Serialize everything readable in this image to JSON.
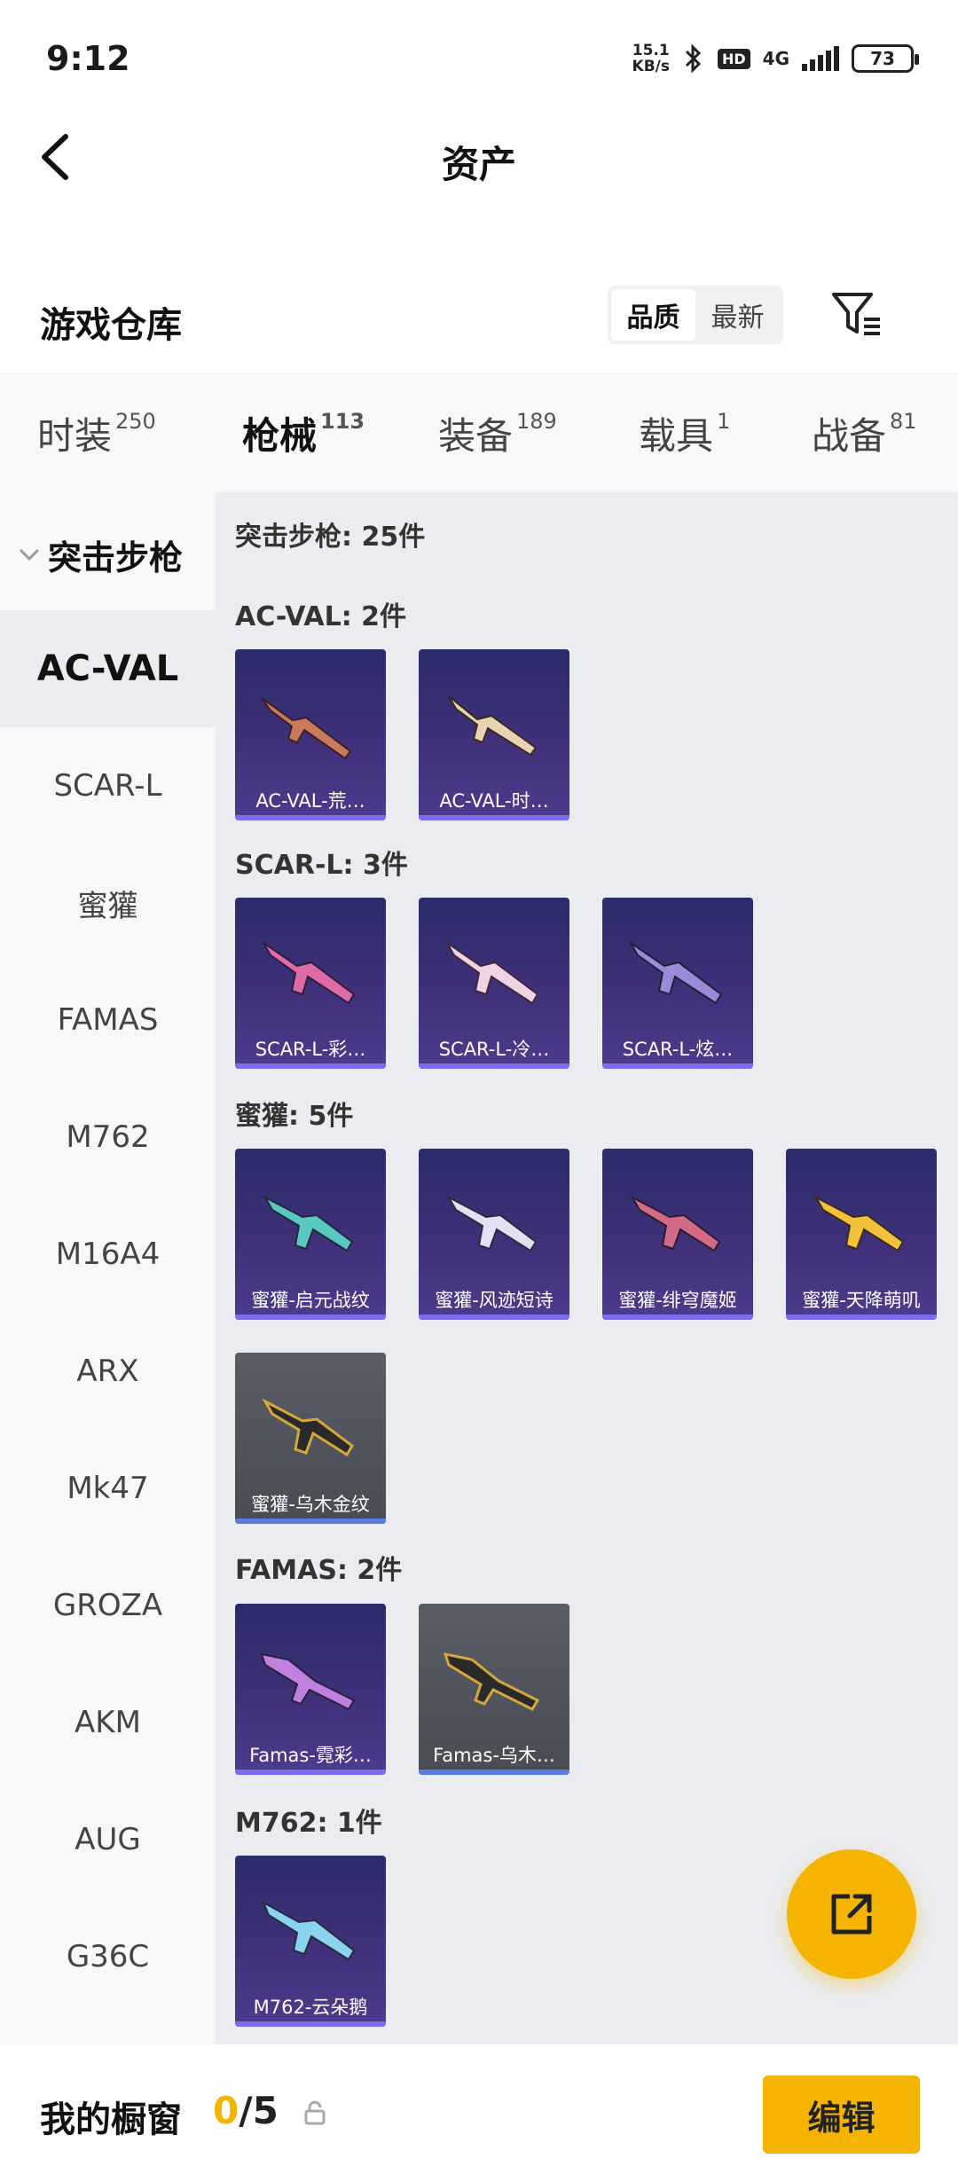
{
  "status_bar": {
    "time": "9:12",
    "speed_value": "15.1",
    "speed_unit": "KB/s",
    "hd_label": "HD",
    "network_label": "4G",
    "battery": "73"
  },
  "nav": {
    "title": "资产"
  },
  "section": {
    "title": "游戏仓库",
    "sort_options": [
      "品质",
      "最新"
    ],
    "active_sort": "品质"
  },
  "tabs": [
    {
      "label": "时装",
      "count": "250"
    },
    {
      "label": "枪械",
      "count": "113"
    },
    {
      "label": "装备",
      "count": "189"
    },
    {
      "label": "载具",
      "count": "1"
    },
    {
      "label": "战备",
      "count": "81"
    }
  ],
  "sidebar": {
    "group": "突击步枪",
    "items": [
      "AC-VAL",
      "SCAR-L",
      "蜜獾",
      "FAMAS",
      "M762",
      "M16A4",
      "ARX",
      "Mk47",
      "GROZA",
      "AKM",
      "AUG",
      "G36C"
    ]
  },
  "content": {
    "summary": "突击步枪: 25件",
    "groups": [
      {
        "heading": "AC-VAL: 2件",
        "cards": [
          {
            "name": "AC-VAL-荒…",
            "bg": "purple"
          },
          {
            "name": "AC-VAL-时…",
            "bg": "purple"
          }
        ]
      },
      {
        "heading": "SCAR-L: 3件",
        "cards": [
          {
            "name": "SCAR-L-彩…",
            "bg": "purple"
          },
          {
            "name": "SCAR-L-冷…",
            "bg": "purple"
          },
          {
            "name": "SCAR-L-炫…",
            "bg": "purple"
          }
        ]
      },
      {
        "heading": "蜜獾: 5件",
        "cards": [
          {
            "name": "蜜獾-启元战纹",
            "bg": "purple"
          },
          {
            "name": "蜜獾-风迹短诗",
            "bg": "purple"
          },
          {
            "name": "蜜獾-绯穹魔姬",
            "bg": "purple"
          },
          {
            "name": "蜜獾-天降萌叽",
            "bg": "purple"
          },
          {
            "name": "蜜獾-乌木金纹",
            "bg": "gray"
          }
        ]
      },
      {
        "heading": "FAMAS: 2件",
        "cards": [
          {
            "name": "Famas-霓彩…",
            "bg": "purple"
          },
          {
            "name": "Famas-乌木…",
            "bg": "gray"
          }
        ]
      },
      {
        "heading": "M762: 1件",
        "cards": [
          {
            "name": "M762-云朵鹅",
            "bg": "purple"
          }
        ]
      }
    ]
  },
  "bottom_bar": {
    "title": "我的橱窗",
    "current": "0",
    "max": "/5",
    "edit_label": "编辑"
  },
  "colors": {
    "accent": "#f5b400",
    "card_purple": "#3a2f78",
    "card_gray": "#53555d"
  }
}
